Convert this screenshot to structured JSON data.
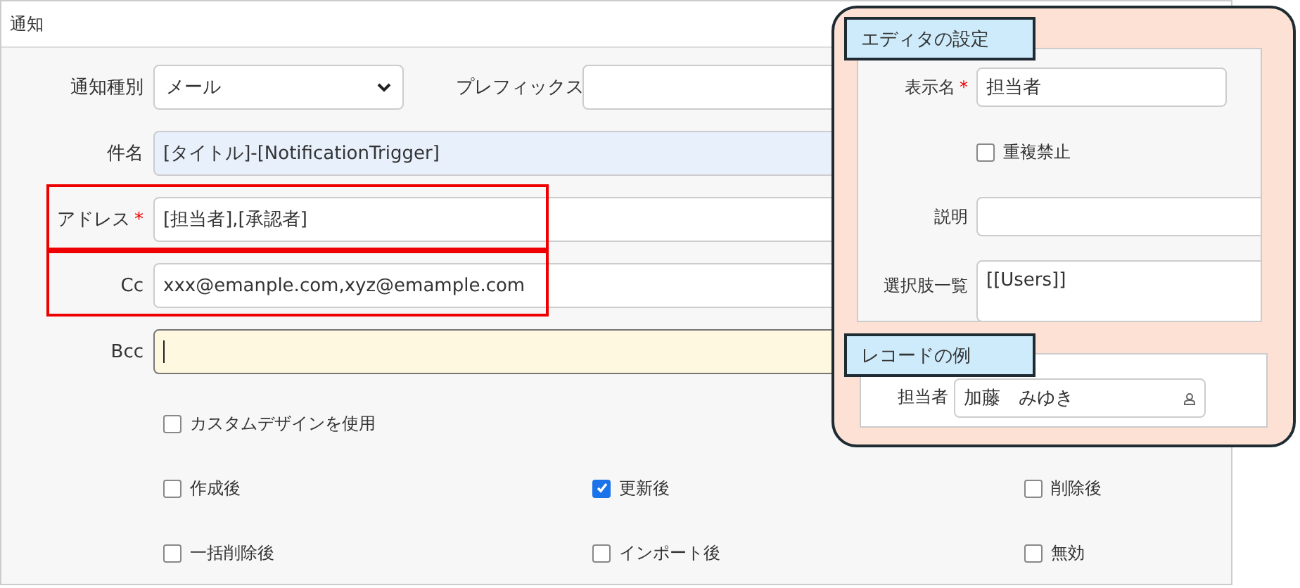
{
  "window": {
    "title": "通知"
  },
  "type_row": {
    "label": "通知種別",
    "value": "メール",
    "prefix_label": "プレフィックス"
  },
  "fields": [
    {
      "label": "件名",
      "kind": "filled",
      "value": "[タイトル]-[NotificationTrigger]",
      "annotated": false
    },
    {
      "label": "アドレス",
      "required_mark": "*",
      "kind": "text",
      "value": "[担当者],[承認者]",
      "annotated": true
    },
    {
      "label": "Cc",
      "kind": "text",
      "value": "xxx@emanple.com,xyz@emample.com",
      "annotated": true
    },
    {
      "label": "Bcc",
      "kind": "focused",
      "annotated": false
    }
  ],
  "custom_design": {
    "label": "カスタムデザインを使用",
    "checked": false
  },
  "triggers": [
    {
      "label": "作成後",
      "checked": false
    },
    {
      "label": "更新後",
      "checked": true
    },
    {
      "label": "削除後",
      "checked": false
    },
    {
      "label": "一括削除後",
      "checked": false
    },
    {
      "label": "インポート後",
      "checked": false
    },
    {
      "label": "無効",
      "checked": false
    }
  ],
  "callout": {
    "editor_title": "エディタの設定",
    "display_name": {
      "label": "表示名",
      "required_mark": "*",
      "value": "担当者"
    },
    "no_duplicates": {
      "label": "重複禁止",
      "checked": false
    },
    "description": {
      "label": "説明"
    },
    "choices": {
      "label": "選択肢一覧",
      "value": "[[Users]]"
    },
    "example_title": "レコードの例",
    "example": {
      "label": "担当者",
      "value": "加藤　みゆき"
    }
  }
}
